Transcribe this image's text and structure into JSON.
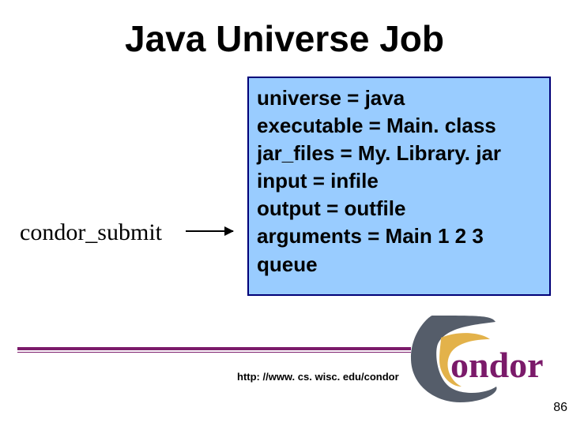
{
  "title": "Java Universe Job",
  "label": "condor_submit",
  "code": {
    "line1": "universe = java",
    "line2": "executable = Main. class",
    "line3": "jar_files = My. Library. jar",
    "line4": "input = infile",
    "line5": "output = outfile",
    "line6": "arguments = Main 1 2 3",
    "line7": "queue"
  },
  "url": "http: //www. cs. wisc. edu/condor",
  "page": "86",
  "logo": {
    "text": "ondor",
    "colors": {
      "c_body": "#555d6a",
      "c_inner": "#e3b24a",
      "text_fill": "#7b1a6a"
    }
  }
}
